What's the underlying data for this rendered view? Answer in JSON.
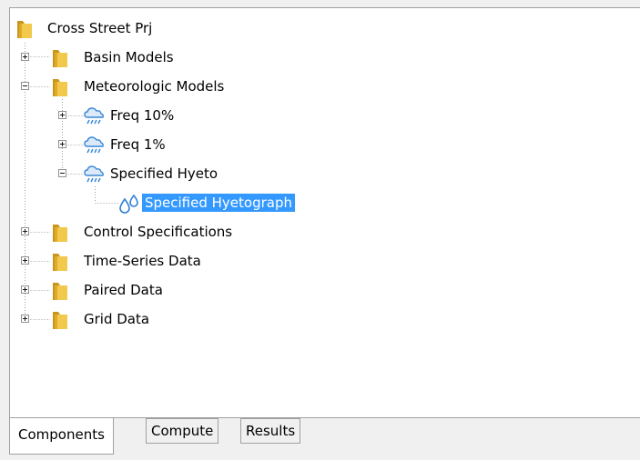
{
  "tree": {
    "root": {
      "label": "Cross Street Prj",
      "icon": "folder-icon"
    },
    "items": [
      {
        "label": "Basin Models",
        "icon": "folder-icon",
        "expander": "plus"
      },
      {
        "label": "Meteorologic Models",
        "icon": "folder-icon",
        "expander": "minus"
      },
      {
        "label": "Freq 10%",
        "icon": "weather-rain-cloud-icon",
        "expander": "plus"
      },
      {
        "label": "Freq 1%",
        "icon": "weather-rain-cloud-icon",
        "expander": "plus"
      },
      {
        "label": "Specified Hyeto",
        "icon": "weather-rain-cloud-icon",
        "expander": "minus"
      },
      {
        "label": "Specified Hyetograph",
        "icon": "water-drops-icon",
        "selected": true
      },
      {
        "label": "Control Specifications",
        "icon": "folder-icon",
        "expander": "plus"
      },
      {
        "label": "Time-Series Data",
        "icon": "folder-icon",
        "expander": "plus"
      },
      {
        "label": "Paired Data",
        "icon": "folder-icon",
        "expander": "plus"
      },
      {
        "label": "Grid Data",
        "icon": "folder-icon",
        "expander": "plus"
      }
    ]
  },
  "tabs": [
    {
      "label": "Components",
      "active": true
    },
    {
      "label": "Compute",
      "active": false
    },
    {
      "label": "Results",
      "active": false
    }
  ],
  "colors": {
    "selection": "#3399ff",
    "folder": "#e8b923",
    "cloud": "#3a87d8"
  }
}
